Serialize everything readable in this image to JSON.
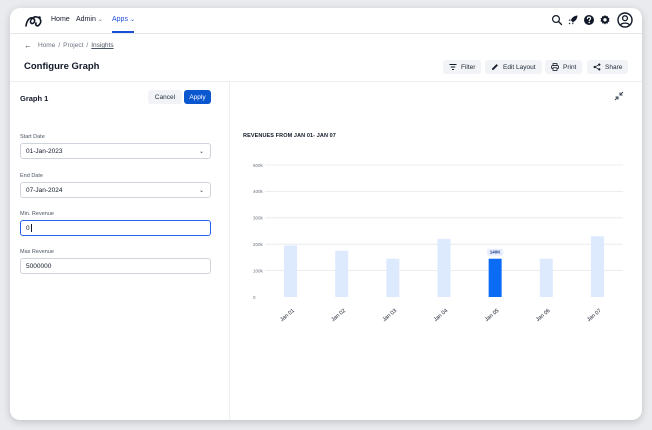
{
  "nav": {
    "items": [
      {
        "label": "Home",
        "has_menu": false
      },
      {
        "label": "Admin",
        "has_menu": true
      },
      {
        "label": "Apps",
        "has_menu": true,
        "active": true
      }
    ],
    "icons": [
      "search-icon",
      "rocket-icon",
      "help-icon",
      "gear-icon",
      "user-avatar-icon"
    ],
    "accent": "#1d4ed8"
  },
  "breadcrumb": {
    "items": [
      "Home",
      "Project",
      "Insights"
    ],
    "separator": "/"
  },
  "page": {
    "title": "Configure Graph"
  },
  "toolbar": {
    "filter_label": "Filter",
    "edit_layout_label": "Edit Layout",
    "print_label": "Print",
    "share_label": "Share"
  },
  "form": {
    "graph_title": "Graph 1",
    "cancel_label": "Cancel",
    "apply_label": "Apply",
    "start_date_label": "Start Date",
    "start_date_value": "01-Jan-2023",
    "end_date_label": "End Date",
    "end_date_value": "07-Jan-2024",
    "min_revenue_label": "Min. Revenue",
    "min_revenue_value": "0",
    "max_revenue_label": "Max Revenue",
    "max_revenue_value": "5000000"
  },
  "chart_data": {
    "type": "bar",
    "title": "REVENUES FROM JAN 01- JAN 07",
    "categories": [
      "Jan 01",
      "Jan 02",
      "Jan 03",
      "Jan 04",
      "Jan 05",
      "Jan 06",
      "Jan 07"
    ],
    "values": [
      195000,
      175000,
      145000,
      220000,
      145000,
      145000,
      230000
    ],
    "highlight_index": 4,
    "highlight_label": "140K",
    "ylim": [
      0,
      500000
    ],
    "yticks": [
      0,
      100000,
      200000,
      300000,
      400000,
      500000
    ],
    "ytick_labels": [
      "0",
      "100k",
      "200k",
      "300k",
      "400k",
      "500k"
    ],
    "grid": true,
    "colors": {
      "bar": "#dde9fd",
      "highlight": "#0a6cf5",
      "grid": "#e5e7eb"
    }
  }
}
